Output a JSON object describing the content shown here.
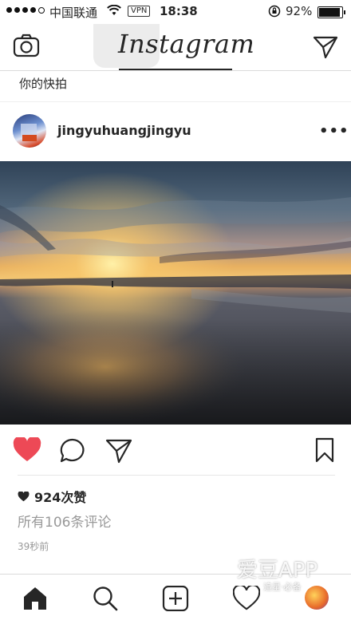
{
  "status_bar": {
    "carrier": "中国联通",
    "vpn": "VPN",
    "time": "18:38",
    "battery": "92%"
  },
  "header": {
    "logo": "Instagram",
    "camera_icon": "camera-icon",
    "direct_icon": "paper-plane-icon"
  },
  "stories": {
    "label": "你的快拍"
  },
  "post": {
    "username": "jingyuhuangjingyu",
    "more": "•••",
    "likes": "924次赞",
    "comments": "所有106条评论",
    "time": "39秒前",
    "liked": true,
    "like_color": "#ed4956"
  },
  "watermark": {
    "text": "爱豆APP",
    "sub": "追星·必备"
  },
  "tabbar": {
    "items": [
      "home-icon",
      "search-icon",
      "add-icon",
      "heart-icon",
      "profile-avatar"
    ]
  }
}
